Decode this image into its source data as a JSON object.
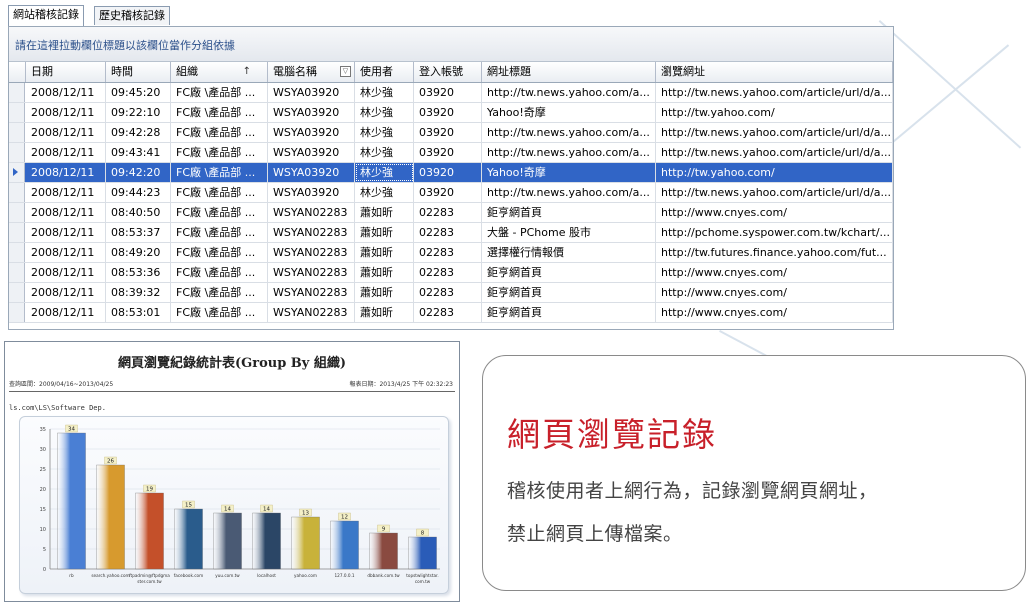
{
  "tabs": [
    {
      "label": "網站稽核記錄",
      "active": true
    },
    {
      "label": "歷史稽核記錄",
      "active": false
    }
  ],
  "grid": {
    "group_hint": "請在這裡拉動欄位標題以該欄位當作分組依據",
    "columns": [
      "日期",
      "時間",
      "組織",
      "電腦名稱",
      "使用者",
      "登入帳號",
      "網址標題",
      "瀏覽網址"
    ],
    "sort_icon": "sort-ascending-icon",
    "filter_icon": "filter-icon",
    "selected_row": 4,
    "rows": [
      [
        "2008/12/11",
        "09:45:20",
        "FC廠 \\產品部 ...",
        "WSYA03920",
        "林少強",
        "03920",
        "http://tw.news.yahoo.com/a...",
        "http://tw.news.yahoo.com/article/url/d/a..."
      ],
      [
        "2008/12/11",
        "09:22:10",
        "FC廠 \\產品部 ...",
        "WSYA03920",
        "林少強",
        "03920",
        "Yahoo!奇摩",
        "http://tw.yahoo.com/"
      ],
      [
        "2008/12/11",
        "09:42:28",
        "FC廠 \\產品部 ...",
        "WSYA03920",
        "林少強",
        "03920",
        "http://tw.news.yahoo.com/a...",
        "http://tw.news.yahoo.com/article/url/d/a..."
      ],
      [
        "2008/12/11",
        "09:43:41",
        "FC廠 \\產品部 ...",
        "WSYA03920",
        "林少強",
        "03920",
        "http://tw.news.yahoo.com/a...",
        "http://tw.news.yahoo.com/article/url/d/a..."
      ],
      [
        "2008/12/11",
        "09:42:20",
        "FC廠 \\產品部 ...",
        "WSYA03920",
        "林少強",
        "03920",
        "Yahoo!奇摩",
        "http://tw.yahoo.com/"
      ],
      [
        "2008/12/11",
        "09:44:23",
        "FC廠 \\產品部 ...",
        "WSYA03920",
        "林少強",
        "03920",
        "http://tw.news.yahoo.com/a...",
        "http://tw.news.yahoo.com/article/url/d/a..."
      ],
      [
        "2008/12/11",
        "08:40:50",
        "FC廠 \\產品部 ...",
        "WSYAN02283",
        "蕭如昕",
        "02283",
        "鉅亨網首頁",
        "http://www.cnyes.com/"
      ],
      [
        "2008/12/11",
        "08:53:37",
        "FC廠 \\產品部 ...",
        "WSYAN02283",
        "蕭如昕",
        "02283",
        "大盤 - PChome 股市",
        "http://pchome.syspower.com.tw/kchart/..."
      ],
      [
        "2008/12/11",
        "08:49:20",
        "FC廠 \\產品部 ...",
        "WSYAN02283",
        "蕭如昕",
        "02283",
        "選擇權行情報價",
        "http://tw.futures.finance.yahoo.com/fut..."
      ],
      [
        "2008/12/11",
        "08:53:36",
        "FC廠 \\產品部 ...",
        "WSYAN02283",
        "蕭如昕",
        "02283",
        "鉅亨網首頁",
        "http://www.cnyes.com/"
      ],
      [
        "2008/12/11",
        "08:39:32",
        "FC廠 \\產品部 ...",
        "WSYAN02283",
        "蕭如昕",
        "02283",
        "鉅亨網首頁",
        "http://www.cnyes.com/"
      ],
      [
        "2008/12/11",
        "08:53:01",
        "FC廠 \\產品部 ...",
        "WSYAN02283",
        "蕭如昕",
        "02283",
        "鉅亨網首頁",
        "http://www.cnyes.com/"
      ]
    ]
  },
  "report": {
    "title": "網頁瀏覽紀錄統計表(Group By 組織)",
    "range": "查詢區間：2009/04/16~2013/04/25",
    "print_date": "報表日期：2013/4/25 下午 02:32:23",
    "org": "ls.com\\LS\\Software Dep.",
    "chart_data": {
      "type": "bar",
      "categories": [
        "rb",
        "search.yahoo.com",
        "ftpadmin@ftpdgmaster.com.tw",
        "facebook.com",
        "yuu.com.tw",
        "localhost",
        "yahoo.com",
        "127.0.0.1",
        "dbbank.com.tw",
        "topstwlightstar.com.tw"
      ],
      "values": [
        34,
        26,
        19,
        15,
        14,
        14,
        13,
        12,
        9,
        8
      ],
      "ylim": [
        0,
        35
      ],
      "yticks": [
        0,
        5,
        10,
        15,
        20,
        25,
        30,
        35
      ],
      "colors": [
        "#4a7fd4",
        "#d79a2e",
        "#c4502a",
        "#2a5c8c",
        "#4a5a74",
        "#2b4666",
        "#c8b23a",
        "#3a78c8",
        "#8a4a40",
        "#2a5cb8"
      ],
      "grid": true
    }
  },
  "card": {
    "heading": "網頁瀏覽記錄",
    "line1": "稽核使用者上網行為，記錄瀏覽網頁網址，",
    "line2": "禁止網頁上傳檔案。"
  }
}
